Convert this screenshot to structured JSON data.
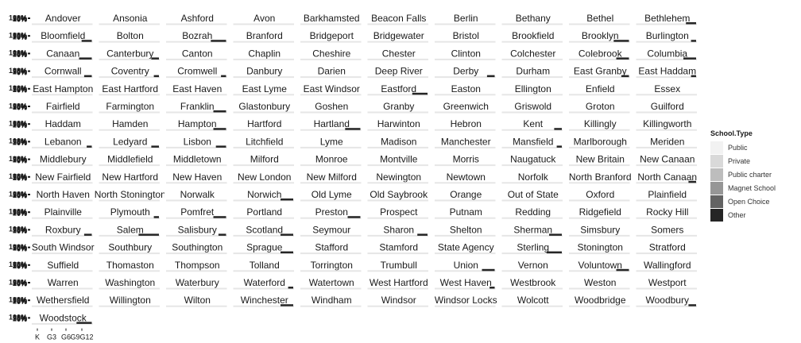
{
  "chart_data": {
    "type": "bar",
    "facet_by": "Town",
    "x_tick_labels": [
      "K",
      "G3",
      "G6",
      "G9G12"
    ],
    "y_tick_labels": [
      "100%",
      "75%",
      "50%",
      "25%",
      "0%"
    ],
    "legend": {
      "title": "School.Type",
      "entries": [
        {
          "name": "Public",
          "color": "#f2f2f2"
        },
        {
          "name": "Private",
          "color": "#d9d9d9"
        },
        {
          "name": "Public charter",
          "color": "#bdbdbd"
        },
        {
          "name": "Magnet School",
          "color": "#969696"
        },
        {
          "name": "Open Choice",
          "color": "#636363"
        },
        {
          "name": "Other",
          "color": "#252525"
        }
      ],
      "placement": "right"
    },
    "marker_series": "Other",
    "towns": [
      {
        "name": "Andover",
        "other": 0
      },
      {
        "name": "Ansonia",
        "other": 0
      },
      {
        "name": "Ashford",
        "other": 0
      },
      {
        "name": "Avon",
        "other": 0
      },
      {
        "name": "Barkhamsted",
        "other": 0
      },
      {
        "name": "Beacon Falls",
        "other": 0
      },
      {
        "name": "Berlin",
        "other": 0
      },
      {
        "name": "Bethany",
        "other": 0
      },
      {
        "name": "Bethel",
        "other": 0
      },
      {
        "name": "Bethlehem",
        "other": 0.08
      },
      {
        "name": "Bloomfield",
        "other": 0.08
      },
      {
        "name": "Bolton",
        "other": 0
      },
      {
        "name": "Bozrah",
        "other": 0.12
      },
      {
        "name": "Branford",
        "other": 0
      },
      {
        "name": "Bridgeport",
        "other": 0
      },
      {
        "name": "Bridgewater",
        "other": 0
      },
      {
        "name": "Bristol",
        "other": 0
      },
      {
        "name": "Brookfield",
        "other": 0
      },
      {
        "name": "Brooklyn",
        "other": 0.12
      },
      {
        "name": "Burlington",
        "other": 0.04
      },
      {
        "name": "Canaan",
        "other": 0.1
      },
      {
        "name": "Canterbury",
        "other": 0.06
      },
      {
        "name": "Canton",
        "other": 0
      },
      {
        "name": "Chaplin",
        "other": 0
      },
      {
        "name": "Cheshire",
        "other": 0
      },
      {
        "name": "Chester",
        "other": 0
      },
      {
        "name": "Clinton",
        "other": 0
      },
      {
        "name": "Colchester",
        "other": 0
      },
      {
        "name": "Colebrook",
        "other": 0.1
      },
      {
        "name": "Columbia",
        "other": 0.1
      },
      {
        "name": "Cornwall",
        "other": 0.06
      },
      {
        "name": "Coventry",
        "other": 0.04
      },
      {
        "name": "Cromwell",
        "other": 0.04
      },
      {
        "name": "Danbury",
        "other": 0
      },
      {
        "name": "Darien",
        "other": 0
      },
      {
        "name": "Deep River",
        "other": 0
      },
      {
        "name": "Derby",
        "other": 0.06
      },
      {
        "name": "Durham",
        "other": 0
      },
      {
        "name": "East Granby",
        "other": 0.06
      },
      {
        "name": "East Haddam",
        "other": 0.04
      },
      {
        "name": "East Hampton",
        "other": 0
      },
      {
        "name": "East Hartford",
        "other": 0
      },
      {
        "name": "East Haven",
        "other": 0
      },
      {
        "name": "East Lyme",
        "other": 0
      },
      {
        "name": "East Windsor",
        "other": 0
      },
      {
        "name": "Eastford",
        "other": 0.12
      },
      {
        "name": "Easton",
        "other": 0
      },
      {
        "name": "Ellington",
        "other": 0
      },
      {
        "name": "Enfield",
        "other": 0
      },
      {
        "name": "Essex",
        "other": 0
      },
      {
        "name": "Fairfield",
        "other": 0
      },
      {
        "name": "Farmington",
        "other": 0
      },
      {
        "name": "Franklin",
        "other": 0.1
      },
      {
        "name": "Glastonbury",
        "other": 0
      },
      {
        "name": "Goshen",
        "other": 0
      },
      {
        "name": "Granby",
        "other": 0
      },
      {
        "name": "Greenwich",
        "other": 0
      },
      {
        "name": "Griswold",
        "other": 0
      },
      {
        "name": "Groton",
        "other": 0
      },
      {
        "name": "Guilford",
        "other": 0
      },
      {
        "name": "Haddam",
        "other": 0
      },
      {
        "name": "Hamden",
        "other": 0
      },
      {
        "name": "Hampton",
        "other": 0.1
      },
      {
        "name": "Hartford",
        "other": 0
      },
      {
        "name": "Hartland",
        "other": 0.12
      },
      {
        "name": "Harwinton",
        "other": 0
      },
      {
        "name": "Hebron",
        "other": 0
      },
      {
        "name": "Kent",
        "other": 0.06
      },
      {
        "name": "Killingly",
        "other": 0
      },
      {
        "name": "Killingworth",
        "other": 0
      },
      {
        "name": "Lebanon",
        "other": 0.04
      },
      {
        "name": "Ledyard",
        "other": 0.06
      },
      {
        "name": "Lisbon",
        "other": 0.08
      },
      {
        "name": "Litchfield",
        "other": 0
      },
      {
        "name": "Lyme",
        "other": 0
      },
      {
        "name": "Madison",
        "other": 0
      },
      {
        "name": "Manchester",
        "other": 0
      },
      {
        "name": "Mansfield",
        "other": 0.04
      },
      {
        "name": "Marlborough",
        "other": 0
      },
      {
        "name": "Meriden",
        "other": 0
      },
      {
        "name": "Middlebury",
        "other": 0
      },
      {
        "name": "Middlefield",
        "other": 0
      },
      {
        "name": "Middletown",
        "other": 0
      },
      {
        "name": "Milford",
        "other": 0
      },
      {
        "name": "Monroe",
        "other": 0
      },
      {
        "name": "Montville",
        "other": 0
      },
      {
        "name": "Morris",
        "other": 0
      },
      {
        "name": "Naugatuck",
        "other": 0
      },
      {
        "name": "New Britain",
        "other": 0
      },
      {
        "name": "New Canaan",
        "other": 0
      },
      {
        "name": "New Fairfield",
        "other": 0
      },
      {
        "name": "New Hartford",
        "other": 0
      },
      {
        "name": "New Haven",
        "other": 0
      },
      {
        "name": "New London",
        "other": 0
      },
      {
        "name": "New Milford",
        "other": 0
      },
      {
        "name": "Newington",
        "other": 0
      },
      {
        "name": "Newtown",
        "other": 0
      },
      {
        "name": "Norfolk",
        "other": 0
      },
      {
        "name": "North Branford",
        "other": 0
      },
      {
        "name": "North Canaan",
        "other": 0.06
      },
      {
        "name": "North Haven",
        "other": 0
      },
      {
        "name": "North Stonington",
        "other": 0
      },
      {
        "name": "Norwalk",
        "other": 0
      },
      {
        "name": "Norwich",
        "other": 0.1
      },
      {
        "name": "Old Lyme",
        "other": 0
      },
      {
        "name": "Old Saybrook",
        "other": 0
      },
      {
        "name": "Orange",
        "other": 0
      },
      {
        "name": "Out of State",
        "other": 0
      },
      {
        "name": "Oxford",
        "other": 0
      },
      {
        "name": "Plainfield",
        "other": 0
      },
      {
        "name": "Plainville",
        "other": 0
      },
      {
        "name": "Plymouth",
        "other": 0.04
      },
      {
        "name": "Pomfret",
        "other": 0.1
      },
      {
        "name": "Portland",
        "other": 0
      },
      {
        "name": "Preston",
        "other": 0.1
      },
      {
        "name": "Prospect",
        "other": 0
      },
      {
        "name": "Putnam",
        "other": 0
      },
      {
        "name": "Redding",
        "other": 0
      },
      {
        "name": "Ridgefield",
        "other": 0
      },
      {
        "name": "Rocky Hill",
        "other": 0
      },
      {
        "name": "Roxbury",
        "other": 0.06
      },
      {
        "name": "Salem",
        "other": 0.16
      },
      {
        "name": "Salisbury",
        "other": 0.06
      },
      {
        "name": "Scotland",
        "other": 0.1
      },
      {
        "name": "Seymour",
        "other": 0
      },
      {
        "name": "Sharon",
        "other": 0.08
      },
      {
        "name": "Shelton",
        "other": 0
      },
      {
        "name": "Sherman",
        "other": 0.1
      },
      {
        "name": "Simsbury",
        "other": 0
      },
      {
        "name": "Somers",
        "other": 0
      },
      {
        "name": "South Windsor",
        "other": 0
      },
      {
        "name": "Southbury",
        "other": 0
      },
      {
        "name": "Southington",
        "other": 0
      },
      {
        "name": "Sprague",
        "other": 0.1
      },
      {
        "name": "Stafford",
        "other": 0
      },
      {
        "name": "Stamford",
        "other": 0
      },
      {
        "name": "State Agency",
        "other": 0
      },
      {
        "name": "Sterling",
        "other": 0.12
      },
      {
        "name": "Stonington",
        "other": 0
      },
      {
        "name": "Stratford",
        "other": 0
      },
      {
        "name": "Suffield",
        "other": 0
      },
      {
        "name": "Thomaston",
        "other": 0
      },
      {
        "name": "Thompson",
        "other": 0
      },
      {
        "name": "Tolland",
        "other": 0
      },
      {
        "name": "Torrington",
        "other": 0
      },
      {
        "name": "Trumbull",
        "other": 0
      },
      {
        "name": "Union",
        "other": 0.1
      },
      {
        "name": "Vernon",
        "other": 0
      },
      {
        "name": "Voluntown",
        "other": 0.1
      },
      {
        "name": "Wallingford",
        "other": 0
      },
      {
        "name": "Warren",
        "other": 0
      },
      {
        "name": "Washington",
        "other": 0
      },
      {
        "name": "Waterbury",
        "other": 0
      },
      {
        "name": "Waterford",
        "other": 0.04
      },
      {
        "name": "Watertown",
        "other": 0
      },
      {
        "name": "West Hartford",
        "other": 0
      },
      {
        "name": "West Haven",
        "other": 0.04
      },
      {
        "name": "Westbrook",
        "other": 0
      },
      {
        "name": "Weston",
        "other": 0
      },
      {
        "name": "Westport",
        "other": 0
      },
      {
        "name": "Wethersfield",
        "other": 0
      },
      {
        "name": "Willington",
        "other": 0
      },
      {
        "name": "Wilton",
        "other": 0
      },
      {
        "name": "Winchester",
        "other": 0.1
      },
      {
        "name": "Windham",
        "other": 0
      },
      {
        "name": "Windsor",
        "other": 0
      },
      {
        "name": "Windsor Locks",
        "other": 0
      },
      {
        "name": "Wolcott",
        "other": 0
      },
      {
        "name": "Woodbridge",
        "other": 0
      },
      {
        "name": "Woodbury",
        "other": 0.06
      },
      {
        "name": "Woodstock",
        "other": 0.12
      }
    ]
  }
}
